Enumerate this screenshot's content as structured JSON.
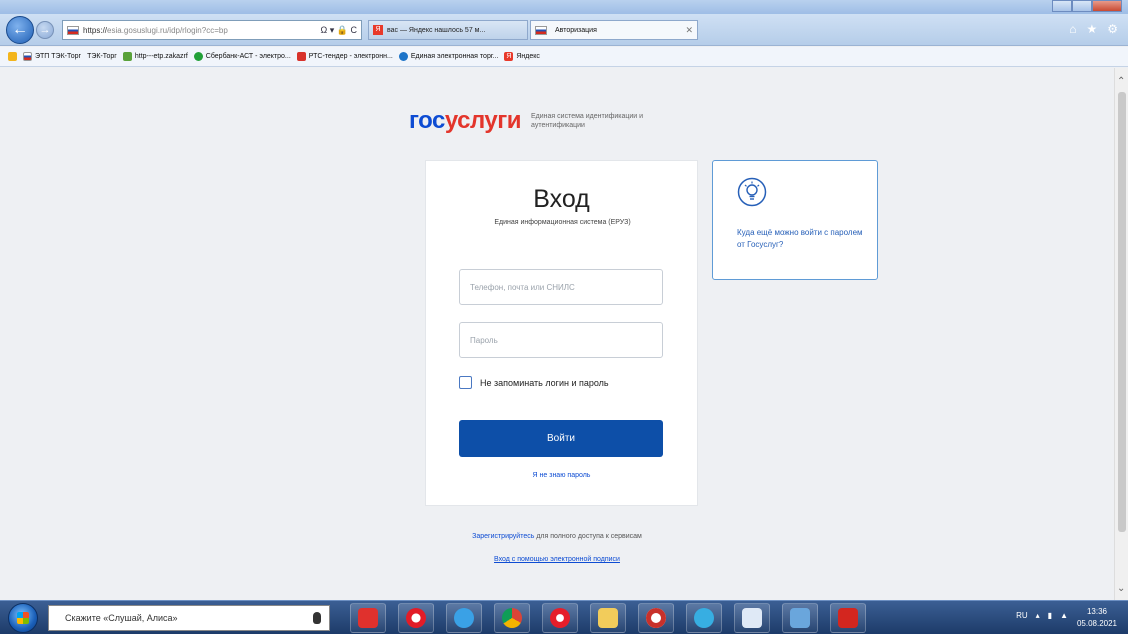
{
  "browser": {
    "address": {
      "scheme": "https://",
      "host": "esia.gosuslugi.ru",
      "path": "/idp/rlogin?cc=bp",
      "tools": "Ω ▾ 🔒 C"
    },
    "tabs": [
      {
        "label": "вас — Яндекс нашлось 57 м...",
        "icon": "yandex-icon"
      },
      {
        "label": "Авторизация",
        "icon": "flag-icon"
      }
    ],
    "favorites": [
      {
        "label": "ЭТП ТЭК-Торг",
        "icon": "flag-icon"
      },
      {
        "label": "ТЭК-Торг",
        "icon": ""
      },
      {
        "label": "http---etp.zakazrf",
        "icon": "zakaz-icon"
      },
      {
        "label": "Сбербанк-АСТ - электро...",
        "icon": "sber-icon"
      },
      {
        "label": "РТС-тендер - электронн...",
        "icon": "rts-icon"
      },
      {
        "label": "Единая электронная торг...",
        "icon": "roseltorg-icon"
      },
      {
        "label": "Яндекс",
        "icon": "yandex-icon"
      }
    ]
  },
  "page": {
    "logo": {
      "part1": "гос",
      "part2": "услуги",
      "subtitle": "Единая система идентификации и аутентификации"
    },
    "login": {
      "title": "Вход",
      "subtitle": "Единая информационная система (ЕРУЗ)",
      "login_placeholder": "Телефон, почта или СНИЛС",
      "password_placeholder": "Пароль",
      "remember_label": "Не запоминать логин и пароль",
      "submit_label": "Войти",
      "forgot_label": "Я не знаю пароль"
    },
    "alt_login": {
      "text": "Куда ещё можно войти с паролем от Госуслуг?"
    },
    "register": {
      "link": "Зарегистрируйтесь",
      "rest": " для полного доступа к сервисам"
    },
    "esign_label": "Вход с помощью электронной подписи"
  },
  "taskbar": {
    "search_placeholder": "Скажите «Слушай, Алиса»",
    "apps": [
      "red-app-icon",
      "opera-icon",
      "ie-icon",
      "chrome-icon",
      "yandex-browser-icon",
      "folder-icon",
      "yandex-disk-icon",
      "telegram-icon",
      "window-icon",
      "monitor-icon",
      "pdf-icon"
    ],
    "lang": "RU",
    "time": "13:36",
    "date": "05.08.2021"
  },
  "colors": {
    "gos_blue": "#0d4cd3",
    "uslugi_red": "#e3352b",
    "button_blue": "#0d4fa8"
  }
}
